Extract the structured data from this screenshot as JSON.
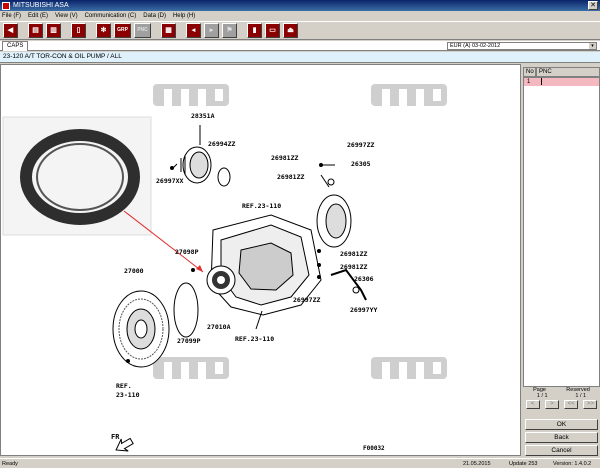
{
  "window": {
    "title": "MITSUBISHI ASA"
  },
  "menu": [
    "File (F)",
    "Edit (E)",
    "View (V)",
    "Communication (C)",
    "Data (D)",
    "Help (H)"
  ],
  "toolbar": {
    "buttons": [
      "back-icon",
      "print-icon",
      "print-all-icon",
      "document-icon",
      "gear-icon",
      "GRP",
      "PNC",
      "grid-icon",
      "prev-icon",
      "next-icon",
      "flag-icon",
      "fuel-icon",
      "notes-icon",
      "exit-icon"
    ]
  },
  "tab": {
    "label": "CAPS"
  },
  "language": {
    "value": "EUR (A)   03-02-2012"
  },
  "path": {
    "text": "23-120  A/T TOR-CON & OIL PUMP / ALL"
  },
  "diagram": {
    "watermark": "MITSUBISHI MOTORS CLUB",
    "labels": {
      "p28351A": "28351A",
      "p26994ZZ": "26994ZZ",
      "p26997XX": "26997XX",
      "p26997ZZ_top": "26997ZZ",
      "p26981ZZ_a": "26981ZZ",
      "p26305": "26305",
      "p26981ZZ_b": "26981ZZ",
      "ref1": "REF.23-110",
      "p27098P": "27098P",
      "p26981ZZ_c": "26981ZZ",
      "p26981ZZ_d": "26981ZZ",
      "p27000": "27000",
      "p26306": "26306",
      "p26997ZZ_bot": "26997ZZ",
      "p26997YY": "26997YY",
      "p27010A": "27010A",
      "p27099P": "27099P",
      "ref2": "REF.23-110",
      "ref3a": "REF.",
      "ref3b": "23-110",
      "fr": "FR",
      "code": "F00032"
    }
  },
  "side": {
    "header_no": "No",
    "header_pnc": "PNC",
    "row_no": "1",
    "page_label": "Page",
    "page_value": "1 / 1",
    "reserved_label": "Reserved",
    "reserved_value": "1 / 1",
    "nav": [
      "<",
      ">",
      "<<",
      ">>"
    ],
    "ok": "OK",
    "back": "Back",
    "cancel": "Cancel"
  },
  "status": {
    "text": "Ready",
    "date": "21.05.2015",
    "update": "Update 253",
    "version": "Version: 1.4.0.2"
  },
  "colors": {
    "brand_red": "#8b0000",
    "selection": "#f4b8c0",
    "path_bg": "#dff1fb"
  }
}
